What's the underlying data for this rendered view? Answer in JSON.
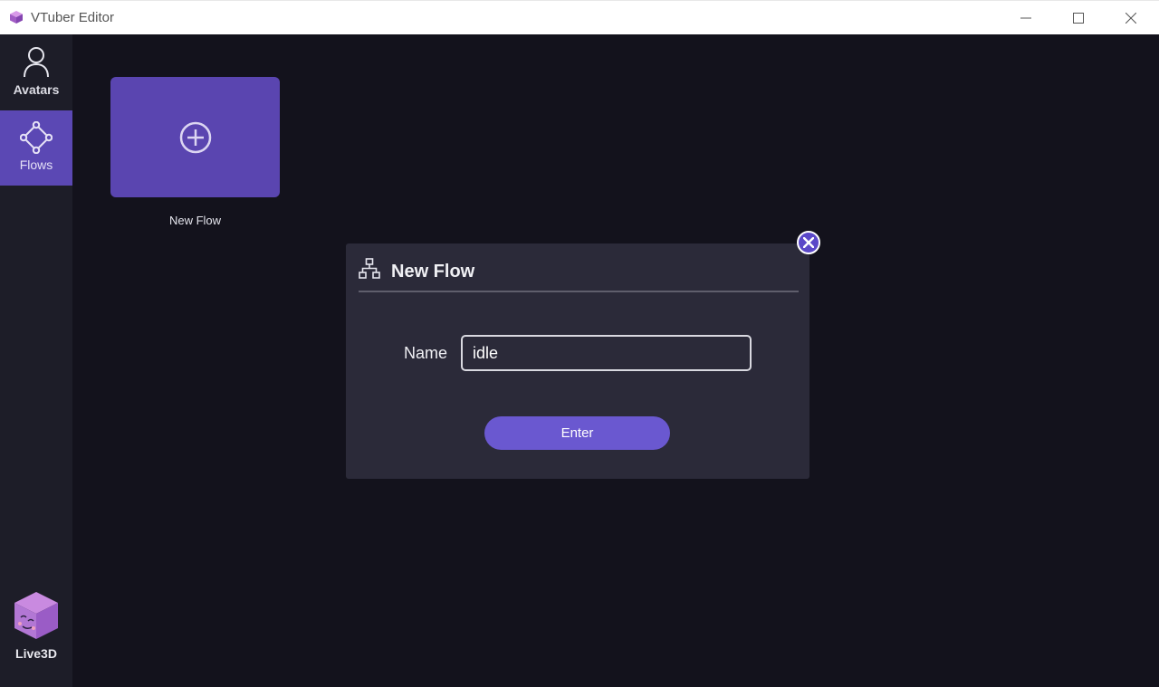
{
  "window": {
    "title": "VTuber Editor",
    "controls": [
      "minimize",
      "maximize",
      "close"
    ]
  },
  "sidebar": {
    "items": [
      {
        "label": "Avatars",
        "icon": "user-icon",
        "active": false
      },
      {
        "label": "Flows",
        "icon": "flow-nodes-icon",
        "active": true
      }
    ],
    "brand": {
      "label": "Live3D",
      "icon": "cube-logo-icon"
    }
  },
  "main": {
    "card": {
      "caption": "New Flow",
      "icon": "plus-circle-icon"
    }
  },
  "dialog": {
    "title": "New Flow",
    "icon": "hierarchy-icon",
    "name_label": "Name",
    "name_value": "idle",
    "enter_label": "Enter",
    "close_icon": "close-icon"
  },
  "colors": {
    "accent": "#5b48b4",
    "button": "#6a58d0",
    "background": "#13121c",
    "sidebar": "#1d1d28",
    "dialog": "#2b2a39"
  }
}
